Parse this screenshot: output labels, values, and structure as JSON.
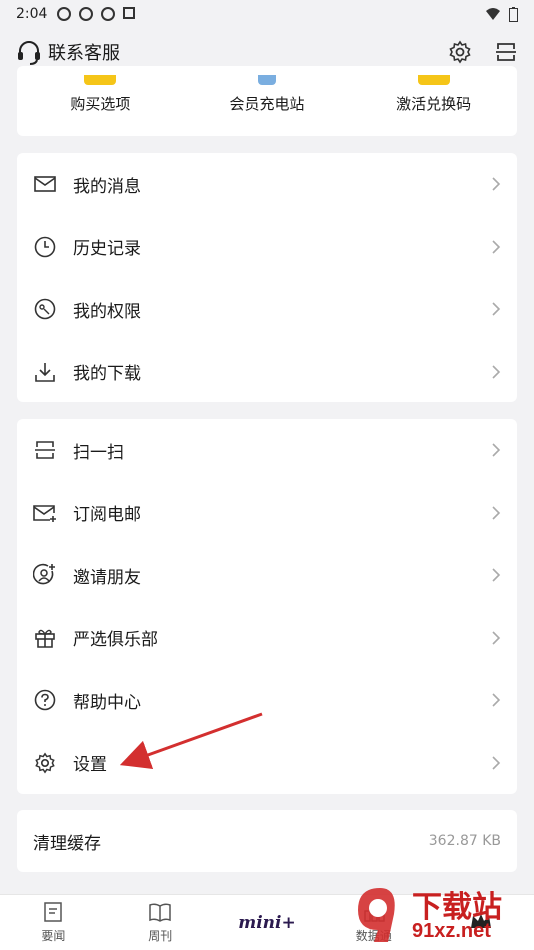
{
  "status_bar": {
    "time": "2:04"
  },
  "header": {
    "title": "联系客服"
  },
  "top_card": {
    "items": [
      {
        "label": "购买选项",
        "color": "#f5c518"
      },
      {
        "label": "会员充电站",
        "color": "#4a90e2"
      },
      {
        "label": "激活兑换码",
        "color": "#f5c518"
      }
    ]
  },
  "group1": [
    {
      "label": "我的消息",
      "icon": "mail-icon"
    },
    {
      "label": "历史记录",
      "icon": "clock-icon"
    },
    {
      "label": "我的权限",
      "icon": "permission-icon"
    },
    {
      "label": "我的下载",
      "icon": "download-icon"
    }
  ],
  "group2": [
    {
      "label": "扫一扫",
      "icon": "scan-icon"
    },
    {
      "label": "订阅电邮",
      "icon": "mail-subscribe-icon"
    },
    {
      "label": "邀请朋友",
      "icon": "invite-icon"
    },
    {
      "label": "严选俱乐部",
      "icon": "gift-icon"
    },
    {
      "label": "帮助中心",
      "icon": "help-icon"
    },
    {
      "label": "设置",
      "icon": "gear-icon"
    }
  ],
  "cache": {
    "label": "清理缓存",
    "value": "362.87 KB"
  },
  "bottom_nav": [
    {
      "label": "要闻",
      "icon": "news-icon"
    },
    {
      "label": "周刊",
      "icon": "book-icon"
    },
    {
      "label": "mini+",
      "icon": "mini-plus-logo"
    },
    {
      "label": "数据通",
      "icon": "chart-icon"
    },
    {
      "label": "",
      "icon": "crown-icon"
    }
  ],
  "watermark": {
    "line1": "下载站",
    "line2": "91xz.net"
  }
}
